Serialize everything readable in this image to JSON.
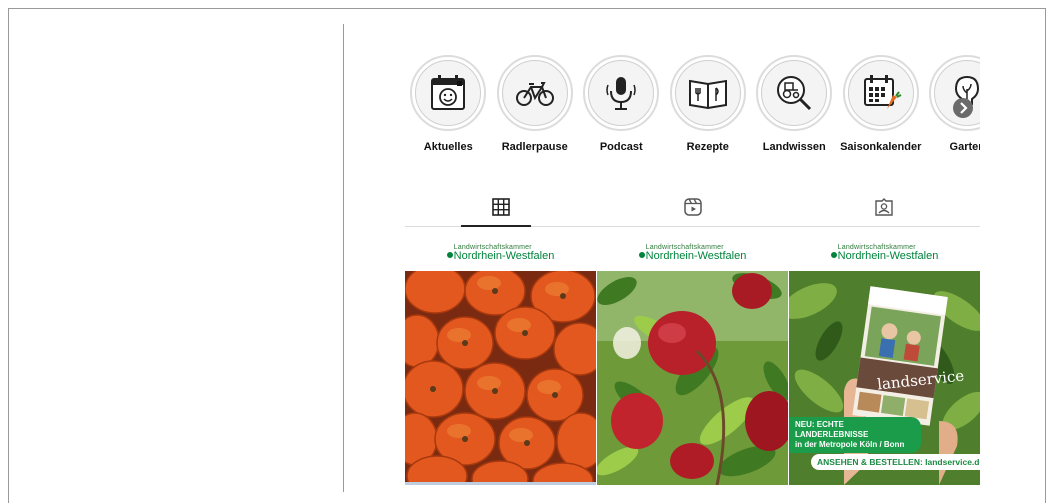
{
  "highlights": [
    {
      "label": "Aktuelles",
      "icon": "calendar-smiley-icon"
    },
    {
      "label": "Radlerpause",
      "icon": "bicycle-icon"
    },
    {
      "label": "Podcast",
      "icon": "microphone-icon"
    },
    {
      "label": "Rezepte",
      "icon": "recipe-book-icon"
    },
    {
      "label": "Landwissen",
      "icon": "tractor-magnifier-icon"
    },
    {
      "label": "Saisonkalender",
      "icon": "calendar-carrot-icon"
    },
    {
      "label": "Garten",
      "icon": "lightbulb-icon"
    }
  ],
  "tabs": [
    {
      "name": "posts",
      "icon": "grid-icon",
      "active": true
    },
    {
      "name": "reels",
      "icon": "reels-icon",
      "active": false
    },
    {
      "name": "tagged",
      "icon": "tagged-icon",
      "active": false
    }
  ],
  "posts": [
    {
      "logo_small": "Landwirtschaftskammer",
      "logo_big": "Nordrhein-Westfalen",
      "image": "pumpkins-photo"
    },
    {
      "logo_small": "Landwirtschaftskammer",
      "logo_big": "Nordrhein-Westfalen",
      "image": "apples-photo"
    },
    {
      "logo_small": "Landwirtschaftskammer",
      "logo_big": "Nordrhein-Westfalen",
      "image": "landservice-magazine-photo",
      "brochure_title": "landservice",
      "banner_line1": "NEU: ECHTE LANDERLEBNISSE",
      "banner_line2": "in der Metropole Köln / Bonn",
      "cta": "ANSEHEN & BESTELLEN: landservice.de"
    }
  ],
  "colors": {
    "brand_green": "#00843d",
    "banner_green": "#1b9c4a"
  }
}
